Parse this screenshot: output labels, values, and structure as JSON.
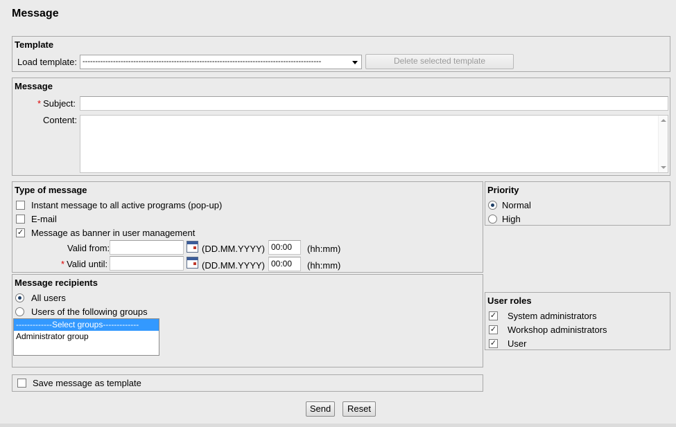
{
  "page": {
    "title": "Message"
  },
  "template": {
    "title": "Template",
    "load_label": "Load template:",
    "load_value": "----------------------------------------------------------------------------------------------",
    "delete_button": "Delete selected template"
  },
  "message": {
    "title": "Message",
    "subject_label": "Subject:",
    "subject_value": "",
    "content_label": "Content:",
    "content_value": ""
  },
  "type": {
    "title": "Type of message",
    "options": [
      {
        "label": "Instant message to all active programs (pop-up)",
        "checked": false
      },
      {
        "label": "E-mail",
        "checked": false
      },
      {
        "label": "Message as banner in user management",
        "checked": true
      }
    ],
    "valid_from_label": "Valid from:",
    "valid_from_date": "",
    "valid_from_time": "00:00",
    "valid_until_label": "Valid until:",
    "valid_until_date": "",
    "valid_until_time": "00:00",
    "date_format": "(DD.MM.YYYY)",
    "time_format": "(hh:mm)"
  },
  "priority": {
    "title": "Priority",
    "options": [
      {
        "label": "Normal",
        "selected": true
      },
      {
        "label": "High",
        "selected": false
      }
    ]
  },
  "recipients": {
    "title": "Message recipients",
    "options": [
      {
        "label": "All users",
        "selected": true
      },
      {
        "label": "Users of the following groups",
        "selected": false
      }
    ],
    "groups": [
      "-------------Select groups-------------",
      "Administrator group"
    ]
  },
  "roles": {
    "title": "User roles",
    "options": [
      {
        "label": "System administrators",
        "checked": true
      },
      {
        "label": "Workshop administrators",
        "checked": true
      },
      {
        "label": "User",
        "checked": true
      }
    ]
  },
  "save_template": {
    "label": "Save message as template",
    "checked": false
  },
  "actions": {
    "send": "Send",
    "reset": "Reset"
  },
  "check_mark": "✓"
}
